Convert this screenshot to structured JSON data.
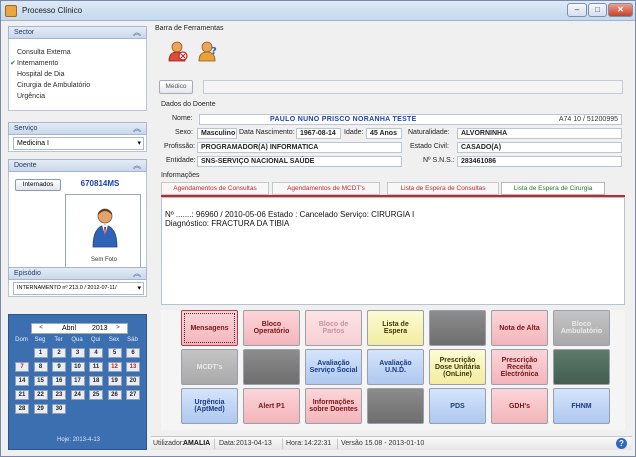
{
  "window": {
    "title": "Processo Clínico",
    "min": "–",
    "max": "□",
    "close": "✕"
  },
  "sidebar": {
    "sector": {
      "title": "Sector",
      "items": [
        {
          "label": "Consulta Externa",
          "checked": false
        },
        {
          "label": "Internamento",
          "checked": true
        },
        {
          "label": "Hospital de Dia",
          "checked": false
        },
        {
          "label": "Cirurgia de Ambulatório",
          "checked": false
        },
        {
          "label": "Urgência",
          "checked": false
        }
      ]
    },
    "servico": {
      "title": "Serviço",
      "value": "Medicina I"
    },
    "doente": {
      "title": "Doente",
      "internados_label": "Internados",
      "patient_number": "670814MS",
      "photo_label": "Sem Foto"
    },
    "episodio": {
      "title": "Episódio",
      "value": "INTERNAMENTO nº 213.0 / 2012-07-11/"
    },
    "calendar": {
      "month": "Abril",
      "year": "2013",
      "day_names": [
        "Dom",
        "Seg",
        "Ter",
        "Qua",
        "Qui",
        "Sex",
        "Sáb"
      ],
      "hoje": "Hoje: 2013-4-13"
    }
  },
  "toolbar": {
    "label": "Barra de Ferramentas"
  },
  "medico": {
    "label": "Médico"
  },
  "patient": {
    "section_label": "Dados do Doente",
    "nome_label": "Nome:",
    "nome_value": "PAULO NUNO PRISCO NORANHA   TESTE",
    "id_value": "A74   10 / 51200995",
    "sexo_label": "Sexo:",
    "sexo_value": "Masculino",
    "nasc_label": "Data Nascimento:",
    "nasc_value": "1967-08-14",
    "idade_label": "Idade:",
    "idade_value": "45 Anos",
    "natural_label": "Naturalidade:",
    "natural_value": "ALVORNINHA",
    "prof_label": "Profissão:",
    "prof_value": "PROGRAMADOR(A) INFORMATICA",
    "civil_label": "Estado Civil:",
    "civil_value": "CASADO(A)",
    "entidade_label": "Entidade:",
    "entidade_value": "SNS-SERVIÇO NACIONAL SAÚDE",
    "sns_label": "Nº S.N.S.:",
    "sns_value": "283461086"
  },
  "info": {
    "label": "Informações",
    "tabs": [
      "Agendamentos de Consultas",
      "Agendamentos de MCDT's",
      "Lista de Espera de Consultas",
      "Lista de Espera de Cirurgia"
    ],
    "line1": "Nº .......: 96960 / 2010-05-06     Estado : Cancelado     Serviço: CIRURGIA I",
    "line2": "Diagnóstico: FRACTURA DA TIBIA"
  },
  "grid_buttons": [
    [
      "Mensagens",
      "Bloco Operatório",
      "Bloco de Partos",
      "Lista de Espera",
      "",
      "Nota de Alta",
      "Bloco Ambulatório"
    ],
    [
      "MCDT's",
      "",
      "Avaliação Serviço Social",
      "Avaliação U.N.D.",
      "Prescrição Dose Unitária (OnLine)",
      "Prescrição Receita Electrónica",
      ""
    ],
    [
      "Urgência (AptMed)",
      "Alert P1",
      "Informações sobre Doentes",
      "",
      "PDS",
      "GDH's",
      "FHNM"
    ]
  ],
  "status": {
    "user_label": "Utilizador:",
    "user_value": "AMALIA",
    "date_label": "Data:",
    "date_value": "2013-04-13",
    "time_label": "Hora:",
    "time_value": "14:22:31",
    "version": "Versão 15.08 - 2013-01-10",
    "help": "?"
  },
  "colors": {
    "accent_red": "#c1272d",
    "patient_blue": "#1f3fb3",
    "calendar_bg": "#3c6fb0"
  }
}
